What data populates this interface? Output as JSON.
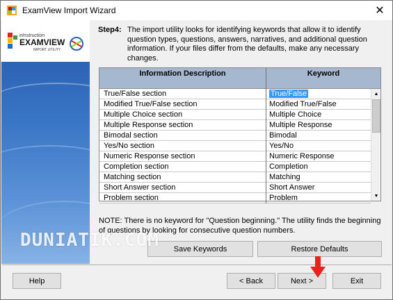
{
  "window": {
    "title": "ExamView Import Wizard"
  },
  "logo": {
    "top_text": "eInstruction",
    "brand": "EXAMVIEW",
    "sub": "IMPORT UTILITY"
  },
  "step": {
    "label": "Step4:",
    "text": "The import utility looks for identifying keywords that allow it to identify question types, questions, answers, narratives, and additional question information.  If your files differ from the defaults, make any necessary changes."
  },
  "table": {
    "headers": [
      "Information Description",
      "Keyword"
    ],
    "rows": [
      {
        "description": "True/False section",
        "keyword": "True/False"
      },
      {
        "description": "Modified True/False section",
        "keyword": "Modified True/False"
      },
      {
        "description": "Multiple Choice section",
        "keyword": "Multiple Choice"
      },
      {
        "description": "Multiple Response section",
        "keyword": "Multiple Response"
      },
      {
        "description": "Bimodal section",
        "keyword": "Bimodal"
      },
      {
        "description": "Yes/No section",
        "keyword": "Yes/No"
      },
      {
        "description": "Numeric Response section",
        "keyword": "Numeric Response"
      },
      {
        "description": "Completion section",
        "keyword": "Completion"
      },
      {
        "description": "Matching section",
        "keyword": "Matching"
      },
      {
        "description": "Short Answer section",
        "keyword": "Short Answer"
      },
      {
        "description": "Problem section",
        "keyword": "Problem"
      }
    ]
  },
  "note": "NOTE: There is no keyword for \"Question beginning.\"  The utility finds the beginning of questions by looking for consecutive question numbers.",
  "buttons": {
    "save": "Save Keywords",
    "restore": "Restore Defaults",
    "help": "Help",
    "back": "< Back",
    "next": "Next >",
    "exit": "Exit"
  },
  "watermark": "DUNIATIK.COM",
  "colors": {
    "header": "#a6b8cf",
    "selection": "#3399ff",
    "arrow": "#e8231e"
  }
}
